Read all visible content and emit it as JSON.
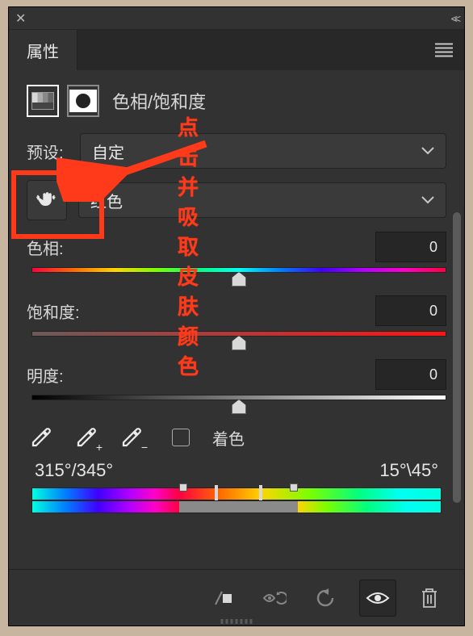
{
  "tab_label": "属性",
  "panel_title": "色相/饱和度",
  "preset": {
    "label": "预设:",
    "value": "自定"
  },
  "channel": {
    "value": "红色"
  },
  "hue": {
    "label": "色相:",
    "value": "0"
  },
  "saturation": {
    "label": "饱和度:",
    "value": "0"
  },
  "lightness": {
    "label": "明度:",
    "value": "0"
  },
  "colorize_label": "着色",
  "range_left": "315°/345°",
  "range_right": "15°\\45°",
  "annotation_text": "点击并吸取皮肤颜色"
}
